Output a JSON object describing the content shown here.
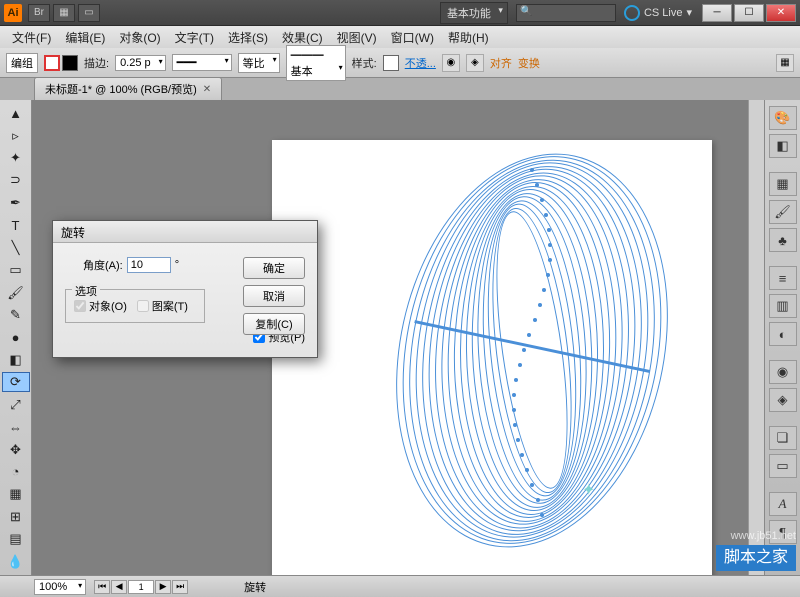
{
  "titlebar": {
    "logo": "Ai",
    "workspace": "基本功能",
    "cslive": "CS Live"
  },
  "menu": {
    "file": "文件(F)",
    "edit": "编辑(E)",
    "object": "对象(O)",
    "type": "文字(T)",
    "select": "选择(S)",
    "effect": "效果(C)",
    "view": "视图(V)",
    "window": "窗口(W)",
    "help": "帮助(H)"
  },
  "options": {
    "group": "编组",
    "stroke_label": "描边:",
    "stroke_weight": "0.25 p",
    "dashes": "等比",
    "profile": "基本",
    "style_label": "样式:",
    "opacity": "不透...",
    "align": "对齐",
    "transform": "变换"
  },
  "document": {
    "tab": "未标题-1* @ 100% (RGB/预览)"
  },
  "dialog": {
    "title": "旋转",
    "angle_label": "角度(A):",
    "angle_value": "10",
    "degree": "°",
    "options_legend": "选项",
    "chk_objects": "对象(O)",
    "chk_patterns": "图案(T)",
    "chk_preview": "预览(P)",
    "btn_ok": "确定",
    "btn_cancel": "取消",
    "btn_copy": "复制(C)"
  },
  "status": {
    "zoom": "100%",
    "page": "1",
    "tool": "旋转"
  },
  "watermark": {
    "url": "www.jb51.net",
    "name": "脚本之家"
  }
}
